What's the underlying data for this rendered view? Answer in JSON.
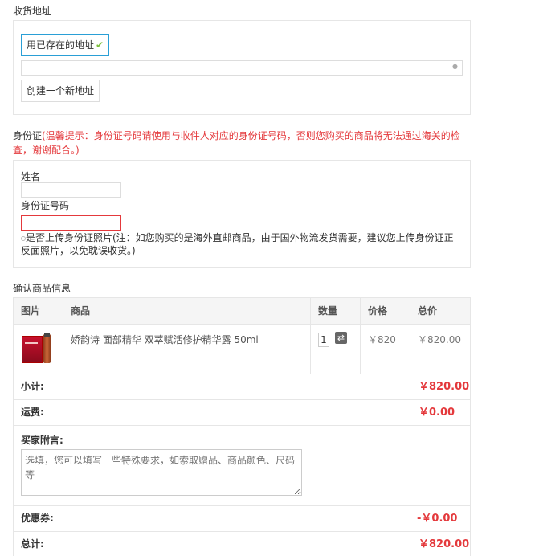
{
  "address": {
    "title": "收货地址",
    "use_existing": "用已存在的地址",
    "select_placeholder": "",
    "create_new": "创建一个新地址"
  },
  "idcard": {
    "title": "身份证",
    "notice": "(温馨提示：身份证号码请使用与收件人对应的身份证号码，否则您购买的商品将无法通过海关的检查，谢谢配合。)",
    "name_label": "姓名",
    "id_label": "身份证号码",
    "upload_hint": "是否上传身份证照片(注：如您购买的是海外直邮商品，由于国外物流发货需要，建议您上传身份证正反面照片，以免耽误收货。)"
  },
  "order": {
    "title": "确认商品信息",
    "headers": [
      "图片",
      "商品",
      "数量",
      "价格",
      "总价"
    ],
    "items": [
      {
        "name": "娇韵诗 面部精华 双萃赋活修护精华露 50ml",
        "qty": "1",
        "price": "￥820",
        "total": "￥820.00"
      }
    ],
    "subtotal_label": "小计:",
    "subtotal_value": "￥820.00",
    "shipping_label": "运费:",
    "shipping_value": "￥0.00",
    "message_label": "买家附言:",
    "message_placeholder": "选填，您可以填写一些特殊要求，如索取赠品、商品颜色、尺码等",
    "coupon_label": "优惠券:",
    "coupon_value": "-￥0.00",
    "total_label": "总计:",
    "total_value": "￥820.00"
  },
  "colors": {
    "accent_red": "#e4393c",
    "border": "#e6e6e6",
    "active_blue": "#2a9fd6",
    "check_green": "#7cbf3c"
  }
}
